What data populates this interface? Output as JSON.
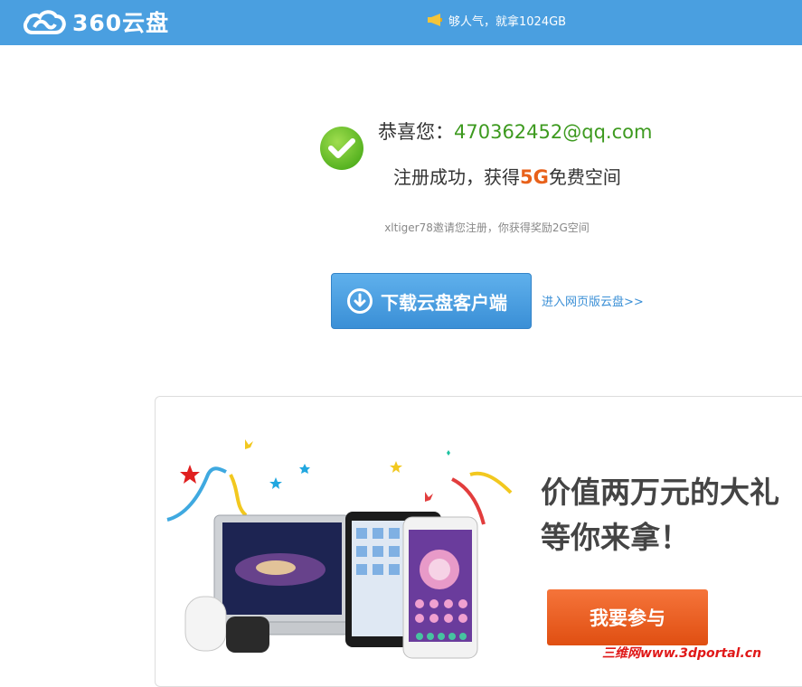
{
  "header": {
    "logo_text": "360云盘",
    "promo_text": "够人气，就拿1024GB"
  },
  "success": {
    "greeting": "恭喜您：",
    "email": "470362452@qq.com",
    "reg_prefix": "注册成功，获得",
    "reg_size": "5G",
    "reg_suffix": "免费空间",
    "invite_text": "xltiger78邀请您注册，你获得奖励2G空间"
  },
  "actions": {
    "download_label": "下载云盘客户端",
    "web_link": "进入网页版云盘>>"
  },
  "promo_card": {
    "title_line1": "价值两万元的大礼",
    "title_line2": "等你来拿！",
    "join_label": "我要参与"
  },
  "watermark": "三维网www.3dportal.cn",
  "colors": {
    "header_bg": "#4a9fe0",
    "accent_green": "#3d9a1f",
    "accent_orange": "#e8611a",
    "button_blue": "#3a8fd6"
  }
}
